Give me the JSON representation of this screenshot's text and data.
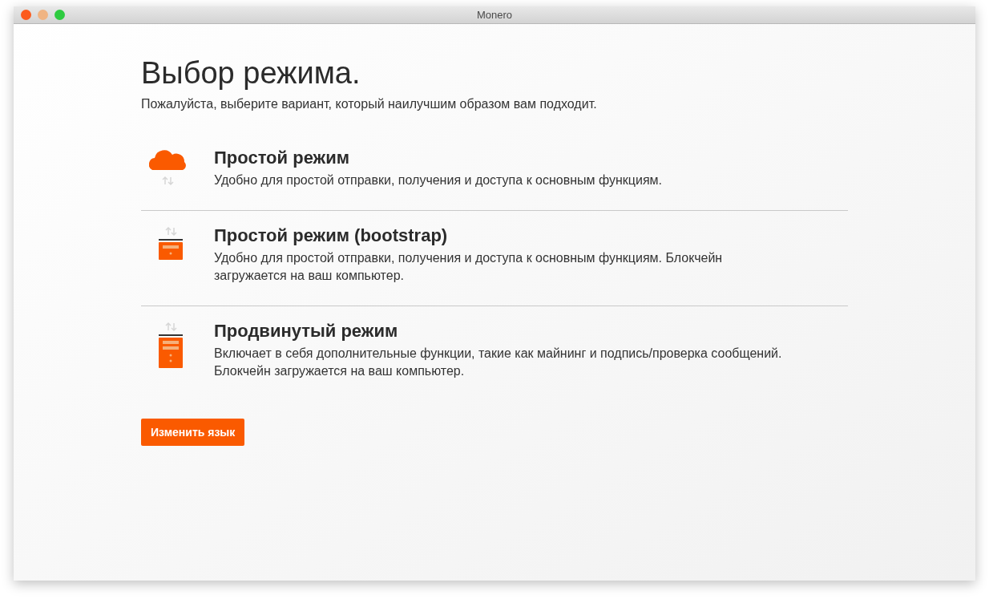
{
  "window": {
    "title": "Monero"
  },
  "heading": "Выбор режима.",
  "subtitle": "Пожалуйста, выберите вариант, который наилучшим образом вам подходит.",
  "modes": [
    {
      "kind": "cloud",
      "title": "Простой режим",
      "description": "Удобно для простой отправки, получения и доступа к основным функциям."
    },
    {
      "kind": "small-server",
      "title": "Простой режим (bootstrap)",
      "description": "Удобно для простой отправки, получения и доступа к основным функциям. Блокчейн загружается на ваш компьютер."
    },
    {
      "kind": "large-server",
      "title": "Продвинутый режим",
      "description": "Включает в себя дополнительные функции, такие как майнинг и подпись/проверка сообщений. Блокчейн загружается на ваш компьютер."
    }
  ],
  "language_button": "Изменить язык"
}
